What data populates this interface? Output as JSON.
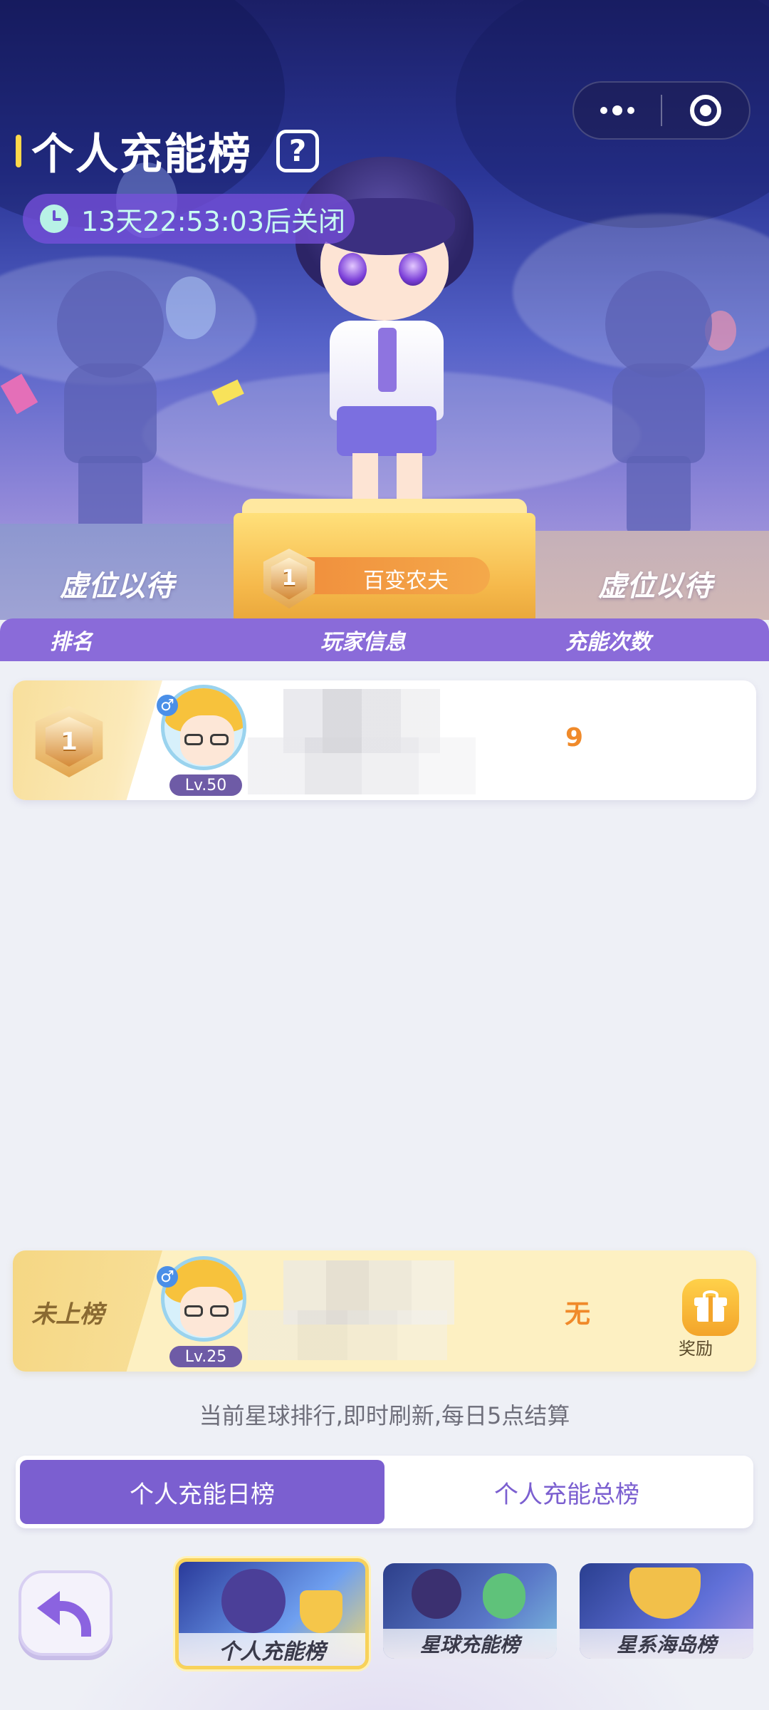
{
  "header": {
    "title": "个人充能榜",
    "help_symbol": "?",
    "countdown": "13天22:53:03后关闭"
  },
  "podium": {
    "left_label": "虚位以待",
    "right_label": "虚位以待",
    "first_rank": "1",
    "first_name": "百变农夫"
  },
  "table": {
    "col_rank": "排名",
    "col_player": "玩家信息",
    "col_count": "充能次数"
  },
  "rows": [
    {
      "rank": "1",
      "gender": "♂",
      "level": "Lv.50",
      "score": "9"
    }
  ],
  "me": {
    "status": "未上榜",
    "gender": "♂",
    "level": "Lv.25",
    "score": "无",
    "reward_label": "奖励"
  },
  "note": "当前星球排行,即时刷新,每日5点结算",
  "tabs": [
    {
      "label": "个人充能日榜",
      "active": true
    },
    {
      "label": "个人充能总榜",
      "active": false
    }
  ],
  "bottom_nav": [
    {
      "label": "个人充能榜",
      "active": true
    },
    {
      "label": "星球充能榜",
      "active": false
    },
    {
      "label": "星系海岛榜",
      "active": false
    }
  ],
  "colors": {
    "accent_purple": "#7b5fd0",
    "score_orange": "#f08a2a",
    "gold": "#f5b84a"
  }
}
